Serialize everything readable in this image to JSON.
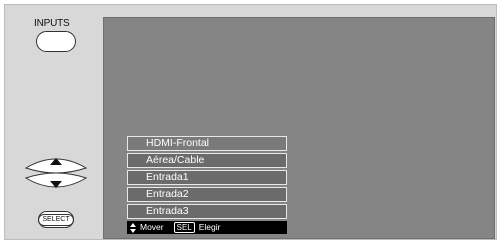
{
  "remote": {
    "inputs_label": "INPUTS",
    "select_label": "SELECT",
    "up_icon": "triangle-up",
    "down_icon": "triangle-down"
  },
  "menu": {
    "items": [
      {
        "label": "HDMI-Frontal",
        "selected": true
      },
      {
        "label": "Aérea/Cable",
        "selected": false
      },
      {
        "label": "Entrada1",
        "selected": false
      },
      {
        "label": "Entrada2",
        "selected": false
      },
      {
        "label": "Entrada3",
        "selected": false
      }
    ],
    "help": {
      "move_label": "Mover",
      "sel_key": "SEL",
      "choose_label": "Elegir"
    }
  },
  "colors": {
    "screen": "#858585",
    "menu_item_bg": "#6b6b6b",
    "help_bar_bg": "#000000",
    "panel_bg": "#d8d8d8"
  }
}
